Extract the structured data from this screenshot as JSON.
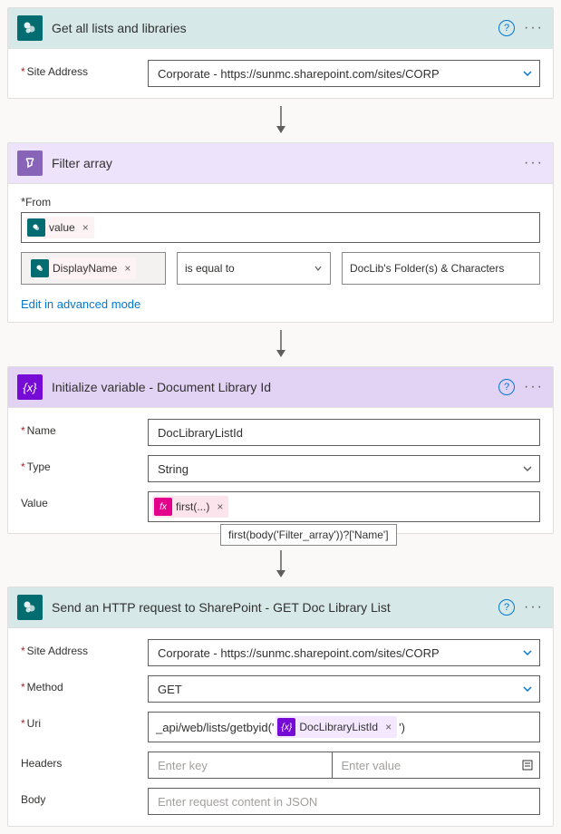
{
  "action1": {
    "title": "Get all lists and libraries",
    "siteAddress": {
      "label": "Site Address",
      "value": "Corporate - https://sunmc.sharepoint.com/sites/CORP"
    }
  },
  "action2": {
    "title": "Filter array",
    "from": {
      "label": "From",
      "token": "value"
    },
    "condition": {
      "left": "DisplayName",
      "op": "is equal to",
      "right": "DocLib's Folder(s) & Characters"
    },
    "advLink": "Edit in advanced mode"
  },
  "action3": {
    "title": "Initialize variable - Document Library Id",
    "name": {
      "label": "Name",
      "value": "DocLibraryListId"
    },
    "type": {
      "label": "Type",
      "value": "String"
    },
    "value": {
      "label": "Value",
      "token": "first(...)",
      "tooltip": "first(body('Filter_array'))?['Name']"
    }
  },
  "action4": {
    "title": "Send an HTTP request to SharePoint - GET Doc Library List",
    "siteAddress": {
      "label": "Site Address",
      "value": "Corporate - https://sunmc.sharepoint.com/sites/CORP"
    },
    "method": {
      "label": "Method",
      "value": "GET"
    },
    "uri": {
      "label": "Uri",
      "prefix": "_api/web/lists/getbyid('",
      "token": "DocLibraryListId",
      "suffix": "')"
    },
    "headers": {
      "label": "Headers",
      "keyPh": "Enter key",
      "valPh": "Enter value"
    },
    "body": {
      "label": "Body",
      "placeholder": "Enter request content in JSON"
    }
  }
}
